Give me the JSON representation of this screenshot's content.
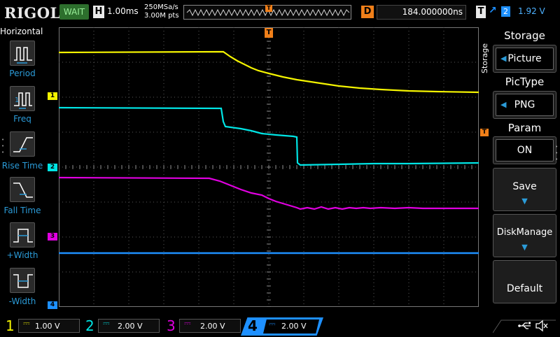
{
  "top": {
    "brand": "RIGOL",
    "status": "WAIT",
    "h_label": "H",
    "timebase": "1.00ms",
    "sample_rate": "250MSa/s",
    "memory_depth": "3.00M pts",
    "trigger_marker": "T",
    "d_label": "D",
    "delay": "184.000000ns",
    "t_label": "T",
    "trigger_edge": "↗",
    "trigger_source": "2",
    "trigger_level": "1.92 V"
  },
  "left": {
    "title": "Horizontal",
    "buttons": [
      {
        "label": "Period"
      },
      {
        "label": "Freq"
      },
      {
        "label": "Rise Time"
      },
      {
        "label": "Fall Time"
      },
      {
        "label": "+Width"
      },
      {
        "label": "-Width"
      }
    ]
  },
  "markers": {
    "ch1": "1",
    "ch2": "2",
    "ch3": "3",
    "ch4": "4",
    "trig_pos": "T",
    "trig_level": "T"
  },
  "right": {
    "side_label": "Storage",
    "menu": [
      {
        "title": "Storage",
        "value": "Picture"
      },
      {
        "title": "PicType",
        "value": "PNG"
      },
      {
        "title": "Param",
        "value": "ON"
      },
      {
        "title": "Save",
        "value": ""
      },
      {
        "title": "DiskManage",
        "value": ""
      },
      {
        "title": "Default",
        "value": ""
      }
    ]
  },
  "channels": [
    {
      "num": "1",
      "scale": "1.00 V",
      "color": "#f4f400"
    },
    {
      "num": "2",
      "scale": "2.00 V",
      "color": "#00e5e5"
    },
    {
      "num": "3",
      "scale": "2.00 V",
      "color": "#e000e0"
    },
    {
      "num": "4",
      "scale": "2.00 V",
      "color": "#1e90ff"
    }
  ],
  "icons": {
    "usb": "usb-icon",
    "sound": "speaker-mute-icon"
  }
}
